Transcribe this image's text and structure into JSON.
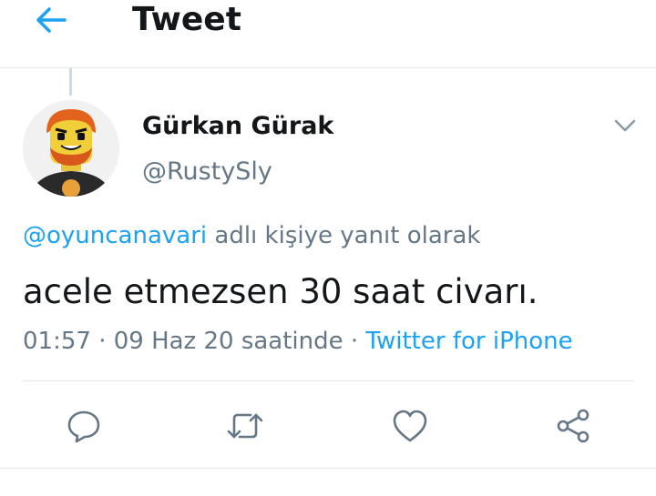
{
  "header": {
    "back_icon": "arrow-left-icon",
    "title": "Tweet"
  },
  "tweet": {
    "author": {
      "display_name": "Gürkan Gürak",
      "handle": "@RustySly",
      "avatar_icon": "lego-minifigure-avatar"
    },
    "menu_icon": "chevron-down-icon",
    "reply_context": {
      "mention": "@oyuncanavari",
      "suffix": " adlı kişiye yanıt olarak"
    },
    "text": "acele etmezsen 30 saat civarı.",
    "meta": {
      "timestamp": "01:57 · 09 Haz 20 saatinde · ",
      "source": "Twitter for iPhone"
    },
    "actions": [
      {
        "name": "reply",
        "icon": "reply-icon"
      },
      {
        "name": "retweet",
        "icon": "retweet-icon"
      },
      {
        "name": "like",
        "icon": "heart-icon"
      },
      {
        "name": "share",
        "icon": "share-icon"
      }
    ]
  },
  "colors": {
    "accent": "#1da1f2",
    "text": "#14171a",
    "secondary": "#657786",
    "divider": "#e1e8ed"
  }
}
